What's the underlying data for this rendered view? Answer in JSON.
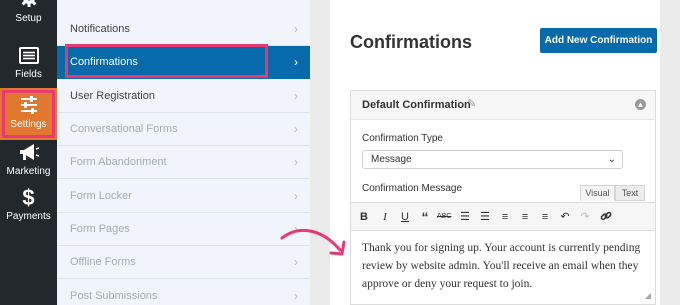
{
  "rail": {
    "items": [
      {
        "label": "Setup",
        "icon": "gear-icon"
      },
      {
        "label": "Fields",
        "icon": "fields-icon"
      },
      {
        "label": "Settings",
        "icon": "sliders-icon"
      },
      {
        "label": "Marketing",
        "icon": "megaphone-icon"
      },
      {
        "label": "Payments",
        "icon": "dollar-icon"
      }
    ]
  },
  "submenu": {
    "items": [
      {
        "label": "Notifications"
      },
      {
        "label": "Confirmations"
      },
      {
        "label": "User Registration"
      },
      {
        "label": "Conversational Forms"
      },
      {
        "label": "Form Abandonment"
      },
      {
        "label": "Form Locker"
      },
      {
        "label": "Form Pages"
      },
      {
        "label": "Offline Forms"
      },
      {
        "label": "Post Submissions"
      }
    ]
  },
  "main": {
    "title": "Confirmations",
    "add_button": "Add New Confirmation",
    "panel": {
      "title": "Default Confirmation",
      "type_label": "Confirmation Type",
      "type_value": "Message",
      "message_label": "Confirmation Message",
      "tab_visual": "Visual",
      "tab_text": "Text",
      "message": "Thank you for signing up. Your account is currently pending review by website admin. You'll receive an email when they approve or deny your request to join."
    }
  },
  "colors": {
    "accent": "#066aab",
    "settings_active": "#e27730",
    "highlight": "#e83a72",
    "rail": "#23282d"
  }
}
